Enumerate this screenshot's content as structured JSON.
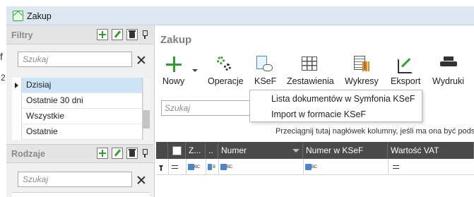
{
  "window": {
    "title": "Zakup"
  },
  "left_strip": {
    "char1": "f",
    "char2": "2"
  },
  "filters_panel": {
    "title": "Filtry",
    "search_placeholder": "Szukaj",
    "items": [
      {
        "label": "Dzisiaj",
        "selected": true
      },
      {
        "label": "Ostatnie 30 dni",
        "selected": false
      },
      {
        "label": "Wszystkie",
        "selected": false
      },
      {
        "label": "Ostatnie",
        "selected": false
      }
    ]
  },
  "types_panel": {
    "title": "Rodzaje",
    "search_placeholder": "Szukaj"
  },
  "main": {
    "title": "Zakup",
    "toolbar": [
      {
        "label": "Nowy",
        "icon": "plus-icon"
      },
      {
        "label": "Operacje",
        "icon": "gears-icon"
      },
      {
        "label": "KSeF",
        "icon": "ksef-icon"
      },
      {
        "label": "Zestawienia",
        "icon": "table-icon"
      },
      {
        "label": "Wykresy",
        "icon": "chart-icon"
      },
      {
        "label": "Eksport",
        "icon": "export-icon"
      },
      {
        "label": "Wydruki",
        "icon": "printer-icon"
      }
    ],
    "ksef_menu": [
      {
        "label": "Lista dokumentów w Symfonia KSeF"
      },
      {
        "label": "Import w formacie KSeF"
      }
    ],
    "search_placeholder": "Szukaj",
    "grouping_hint": "Przeciągnij tutaj nagłówek kolumny, jeśli ma ona być pods",
    "grid": {
      "columns": [
        "Z...",
        "..",
        "Numer",
        "Numer w KSeF",
        "Wartość VAT"
      ],
      "abc_label": "BC",
      "abc_label_b": "B"
    }
  },
  "colors": {
    "accent_green": "#2f9e2f",
    "grid_header": "#4a4a4a",
    "selection": "#cde3f6",
    "titlebar": "#dde7f2"
  }
}
